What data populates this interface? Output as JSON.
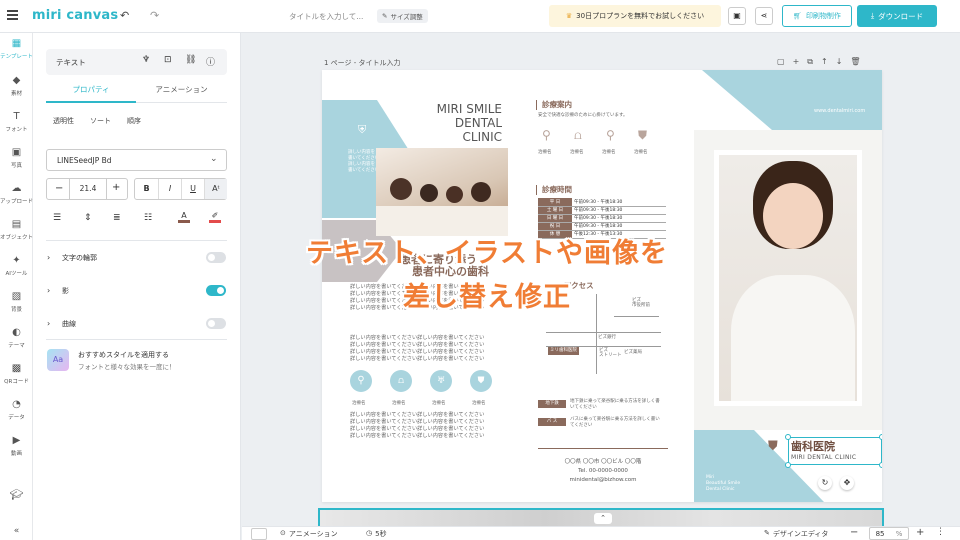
{
  "app": {
    "logo": "miri canvas"
  },
  "topbar": {
    "doc_title": "タイトルを入力して...",
    "resize_label": "サイズ調整",
    "promo_label": "30日プロプランを無料でお試しください",
    "print_label": "印刷物制作",
    "download_label": "ダウンロード"
  },
  "rail": [
    {
      "label": "テンプレート",
      "icon": "template-icon"
    },
    {
      "label": "素材",
      "icon": "elements-icon"
    },
    {
      "label": "フォント",
      "icon": "text-icon"
    },
    {
      "label": "写真",
      "icon": "photo-icon"
    },
    {
      "label": "アップロード",
      "icon": "upload-icon"
    },
    {
      "label": "オブジェクト",
      "icon": "object-icon"
    },
    {
      "label": "AIツール",
      "icon": "ai-tool-icon"
    },
    {
      "label": "背景",
      "icon": "background-icon"
    },
    {
      "label": "テーマ",
      "icon": "theme-icon"
    },
    {
      "label": "QRコード",
      "icon": "qr-icon"
    },
    {
      "label": "データ",
      "icon": "data-icon"
    },
    {
      "label": "動画",
      "icon": "video-icon"
    }
  ],
  "panel": {
    "header": "テキスト",
    "tabs": [
      "プロパティ",
      "アニメーション"
    ],
    "subtabs": [
      "透明性",
      "ソート",
      "順序"
    ],
    "font": "LINESeedJP Bd",
    "font_size": "21.4",
    "format_buttons": [
      "B",
      "I",
      "U"
    ],
    "options": [
      {
        "label": "文字の輪郭",
        "on": false
      },
      {
        "label": "影",
        "on": true
      },
      {
        "label": "曲線",
        "on": false
      }
    ],
    "style_title": "おすすめスタイルを適用する",
    "style_desc": "フォントと様々な効果を一度に！",
    "ai_badge": "ai"
  },
  "canvas": {
    "page_label": "1 ページ - タイトル入力",
    "overlay_line1": "テキスト、イラストや画像を",
    "overlay_line2": "差し替え修正"
  },
  "flyer": {
    "clinic_title": [
      "MIRI SMILE",
      "DENTAL",
      "CLINIC"
    ],
    "badge_text": [
      "詳しい内容を",
      "書いてください",
      "詳しい内容を",
      "書いてください"
    ],
    "website": "www.dentalmiri.com",
    "guide_title": "診療案内",
    "guide_desc": "安全で快適な診療のために心掛けています。",
    "services": [
      "治療名",
      "治療名",
      "治療名",
      "治療名"
    ],
    "hours_title": "診療時間",
    "schedule": [
      {
        "day": "平 日",
        "time": "午前09:30 - 午後18:30"
      },
      {
        "day": "土 曜 日",
        "time": "午前09:30 - 午後18:30"
      },
      {
        "day": "日 曜 日",
        "time": "午前09:30 - 午後18:30"
      },
      {
        "day": "祝 日",
        "time": "午前09:30 - 午後18:30"
      },
      {
        "day": "休 憩",
        "time": "午後12:30 - 午後13:30"
      }
    ],
    "headline": "患者に寄り添う",
    "headline2": "患者中心の歯科",
    "body_text": "詳しい内容を書いてください詳しい内容を書いてください",
    "access_title": "アクセス",
    "map_labels": [
      "ビズ",
      "市役所前",
      "ビズ銀行",
      "ミリ歯科医院",
      "ビズ",
      "ストリート",
      "ビズ薬局"
    ],
    "transport": [
      {
        "tag": "地下鉄",
        "text": "地下鉄に乗って楽谷駅に乗る方法を詳しく書いてください"
      },
      {
        "tag": "バ ス",
        "text": "バスに乗って楽谷駅に乗る方法を詳しく書いてください"
      }
    ],
    "icons_row": [
      "治療名",
      "治療名",
      "治療名",
      "治療名"
    ],
    "address": "〇〇県 〇〇市 〇〇ビル 〇〇階",
    "tel": "Tel. 00-0000-0000",
    "email": "minidental@bizhow.com",
    "footer_name": "歯科医院",
    "footer_sub": "MIRI DENTAL CLINIC",
    "footer_tagline": [
      "Miri",
      "Beautiful Smile",
      "Dental Clinic"
    ]
  },
  "bottombar": {
    "animation_label": "アニメーション",
    "duration_label": "5秒",
    "design_editor_label": "デザインエディタ",
    "zoom": "85",
    "zoom_unit": "%"
  },
  "colors": {
    "accent": "#2eb7c9",
    "flyer_blue": "#a9d4de",
    "flyer_brown": "#8a6a5c",
    "overlay": "#f07d35"
  }
}
